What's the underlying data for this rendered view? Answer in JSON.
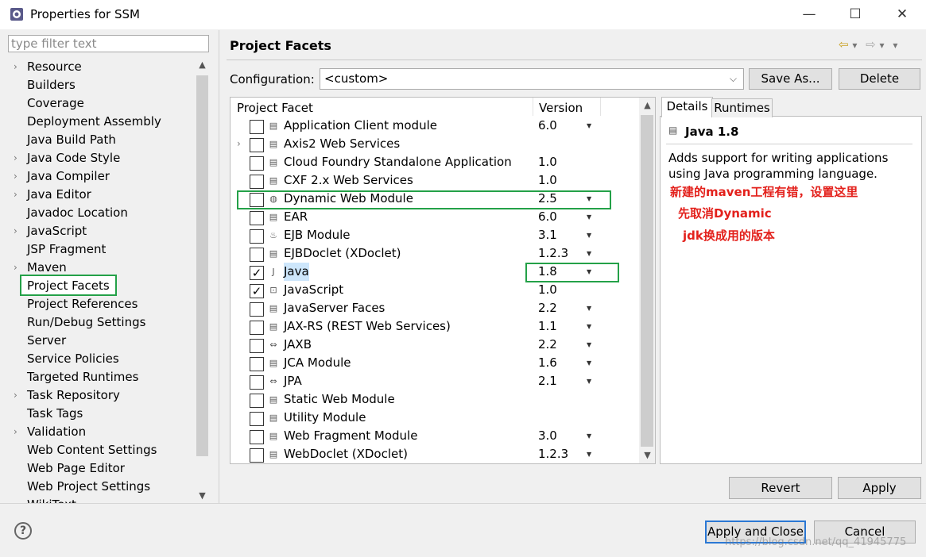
{
  "window": {
    "title": "Properties for SSM",
    "controls": {
      "minimize": "—",
      "maximize": "☐",
      "close": "✕"
    }
  },
  "filter": {
    "placeholder": "type filter text"
  },
  "sidebar": {
    "items": [
      {
        "label": "Resource",
        "expandable": true
      },
      {
        "label": "Builders",
        "expandable": false
      },
      {
        "label": "Coverage",
        "expandable": false
      },
      {
        "label": "Deployment Assembly",
        "expandable": false
      },
      {
        "label": "Java Build Path",
        "expandable": false
      },
      {
        "label": "Java Code Style",
        "expandable": true
      },
      {
        "label": "Java Compiler",
        "expandable": true
      },
      {
        "label": "Java Editor",
        "expandable": true
      },
      {
        "label": "Javadoc Location",
        "expandable": false
      },
      {
        "label": "JavaScript",
        "expandable": true
      },
      {
        "label": "JSP Fragment",
        "expandable": false
      },
      {
        "label": "Maven",
        "expandable": true
      },
      {
        "label": "Project Facets",
        "expandable": false,
        "selected": true
      },
      {
        "label": "Project References",
        "expandable": false
      },
      {
        "label": "Run/Debug Settings",
        "expandable": false
      },
      {
        "label": "Server",
        "expandable": false
      },
      {
        "label": "Service Policies",
        "expandable": false
      },
      {
        "label": "Targeted Runtimes",
        "expandable": false
      },
      {
        "label": "Task Repository",
        "expandable": true
      },
      {
        "label": "Task Tags",
        "expandable": false
      },
      {
        "label": "Validation",
        "expandable": true
      },
      {
        "label": "Web Content Settings",
        "expandable": false
      },
      {
        "label": "Web Page Editor",
        "expandable": false
      },
      {
        "label": "Web Project Settings",
        "expandable": false
      },
      {
        "label": "WikiText",
        "expandable": false
      }
    ]
  },
  "header": {
    "title": "Project Facets",
    "back_icon": "⇦",
    "forward_icon": "⇨",
    "menu_icon": "▾"
  },
  "configuration": {
    "label": "Configuration:",
    "value": "<custom>",
    "save_as": "Save As...",
    "delete": "Delete"
  },
  "facets": {
    "col_facet": "Project Facet",
    "col_version": "Version",
    "rows": [
      {
        "name": "Application Client module",
        "version": "6.0",
        "checked": false,
        "dropdown": true,
        "icon": "doc-icon",
        "glyph": "▤"
      },
      {
        "name": "Axis2 Web Services",
        "version": "",
        "checked": false,
        "dropdown": false,
        "expandable": true,
        "icon": "doc-icon",
        "glyph": "▤"
      },
      {
        "name": "Cloud Foundry Standalone Application",
        "version": "1.0",
        "checked": false,
        "dropdown": false,
        "icon": "doc-icon",
        "glyph": "▤"
      },
      {
        "name": "CXF 2.x Web Services",
        "version": "1.0",
        "checked": false,
        "dropdown": false,
        "icon": "doc-icon",
        "glyph": "▤"
      },
      {
        "name": "Dynamic Web Module",
        "version": "2.5",
        "checked": false,
        "dropdown": true,
        "icon": "globe-icon",
        "glyph": "◍"
      },
      {
        "name": "EAR",
        "version": "6.0",
        "checked": false,
        "dropdown": true,
        "icon": "doc-icon",
        "glyph": "▤"
      },
      {
        "name": "EJB Module",
        "version": "3.1",
        "checked": false,
        "dropdown": true,
        "icon": "bean-icon",
        "glyph": "♨"
      },
      {
        "name": "EJBDoclet (XDoclet)",
        "version": "1.2.3",
        "checked": false,
        "dropdown": true,
        "icon": "doc-icon",
        "glyph": "▤"
      },
      {
        "name": "Java",
        "version": "1.8",
        "checked": true,
        "dropdown": true,
        "icon": "java-icon",
        "glyph": "J",
        "highlighted": true
      },
      {
        "name": "JavaScript",
        "version": "1.0",
        "checked": true,
        "dropdown": false,
        "icon": "js-lock-icon",
        "glyph": "⊡"
      },
      {
        "name": "JavaServer Faces",
        "version": "2.2",
        "checked": false,
        "dropdown": true,
        "icon": "doc-icon",
        "glyph": "▤"
      },
      {
        "name": "JAX-RS (REST Web Services)",
        "version": "1.1",
        "checked": false,
        "dropdown": true,
        "icon": "doc-icon",
        "glyph": "▤"
      },
      {
        "name": "JAXB",
        "version": "2.2",
        "checked": false,
        "dropdown": true,
        "icon": "jaxb-icon",
        "glyph": "⇔"
      },
      {
        "name": "JCA Module",
        "version": "1.6",
        "checked": false,
        "dropdown": true,
        "icon": "doc-icon",
        "glyph": "▤"
      },
      {
        "name": "JPA",
        "version": "2.1",
        "checked": false,
        "dropdown": true,
        "icon": "jpa-icon",
        "glyph": "⇔"
      },
      {
        "name": "Static Web Module",
        "version": "",
        "checked": false,
        "dropdown": false,
        "icon": "doc-icon",
        "glyph": "▤"
      },
      {
        "name": "Utility Module",
        "version": "",
        "checked": false,
        "dropdown": false,
        "icon": "doc-icon",
        "glyph": "▤"
      },
      {
        "name": "Web Fragment Module",
        "version": "3.0",
        "checked": false,
        "dropdown": true,
        "icon": "doc-icon",
        "glyph": "▤"
      },
      {
        "name": "WebDoclet (XDoclet)",
        "version": "1.2.3",
        "checked": false,
        "dropdown": true,
        "icon": "doc-icon",
        "glyph": "▤"
      }
    ]
  },
  "details": {
    "tab_details": "Details",
    "tab_runtimes": "Runtimes",
    "title": "Java 1.8",
    "description": "Adds support for writing applications using Java programming language.",
    "annotation_lines": [
      "新建的maven工程有错，设置这里",
      "先取消Dynamic",
      "jdk换成用的版本"
    ]
  },
  "actions": {
    "revert": "Revert",
    "apply": "Apply",
    "apply_close": "Apply and Close",
    "cancel": "Cancel"
  },
  "help": {
    "glyph": "?"
  },
  "watermark": "https://blog.csdn.net/qq_41945775",
  "colors": {
    "highlight_box": "#24a148",
    "annotation": "#e3211c",
    "selection": "#cde6fb"
  }
}
